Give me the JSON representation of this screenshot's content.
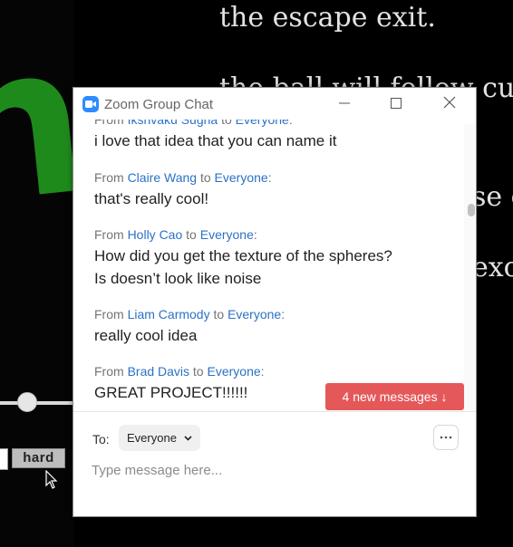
{
  "background": {
    "text_lines": [
      "the escape exit.",
      "the ball will follow cur",
      "se c",
      "exc"
    ],
    "button_hard": "hard"
  },
  "chat": {
    "title": "Zoom Group Chat",
    "messages": [
      {
        "from": "Ikshvaku Sugna",
        "to": "Everyone",
        "text": [
          "i love that idea that you can name it"
        ]
      },
      {
        "from": "Claire Wang",
        "to": "Everyone",
        "text": [
          "that's really cool!"
        ]
      },
      {
        "from": "Holly Cao",
        "to": "Everyone",
        "text": [
          "How did you get the texture of the spheres?",
          "Is doesn’t look like noise"
        ]
      },
      {
        "from": "Liam Carmody",
        "to": "Everyone",
        "text": [
          "really cool idea"
        ]
      },
      {
        "from": "Brad Davis",
        "to": "Everyone",
        "text": [
          "GREAT PROJECT!!!!!!"
        ]
      }
    ],
    "from_word": "From",
    "to_word": "to",
    "new_messages_label": "4 new messages ↓",
    "to_label": "To:",
    "recipient": "Everyone",
    "input_placeholder": "Type message here...",
    "colors": {
      "accent": "#2d8cff",
      "link": "#2b72c4",
      "alert": "#e5585a"
    }
  }
}
